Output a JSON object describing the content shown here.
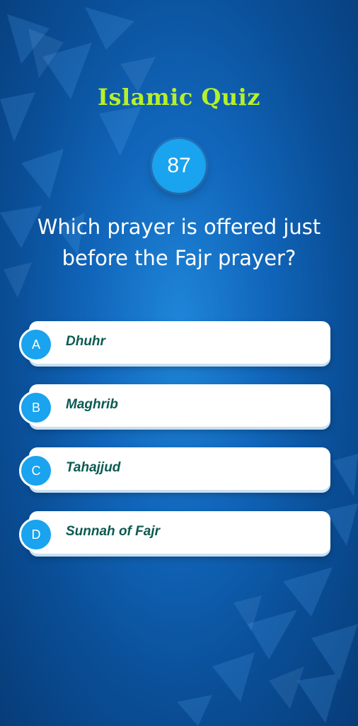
{
  "quiz": {
    "title": "Islamic Quiz",
    "question_number": "87",
    "question": "Which prayer is offered just before the Fajr prayer?"
  },
  "options": [
    {
      "letter": "A",
      "text": "Dhuhr"
    },
    {
      "letter": "B",
      "text": "Maghrib"
    },
    {
      "letter": "C",
      "text": "Tahajjud"
    },
    {
      "letter": "D",
      "text": "Sunnah of Fajr"
    }
  ],
  "colors": {
    "title": "#b6f02a",
    "accent": "#1aa3ee",
    "background": "#1166bb",
    "option_text": "#0b5a52"
  }
}
